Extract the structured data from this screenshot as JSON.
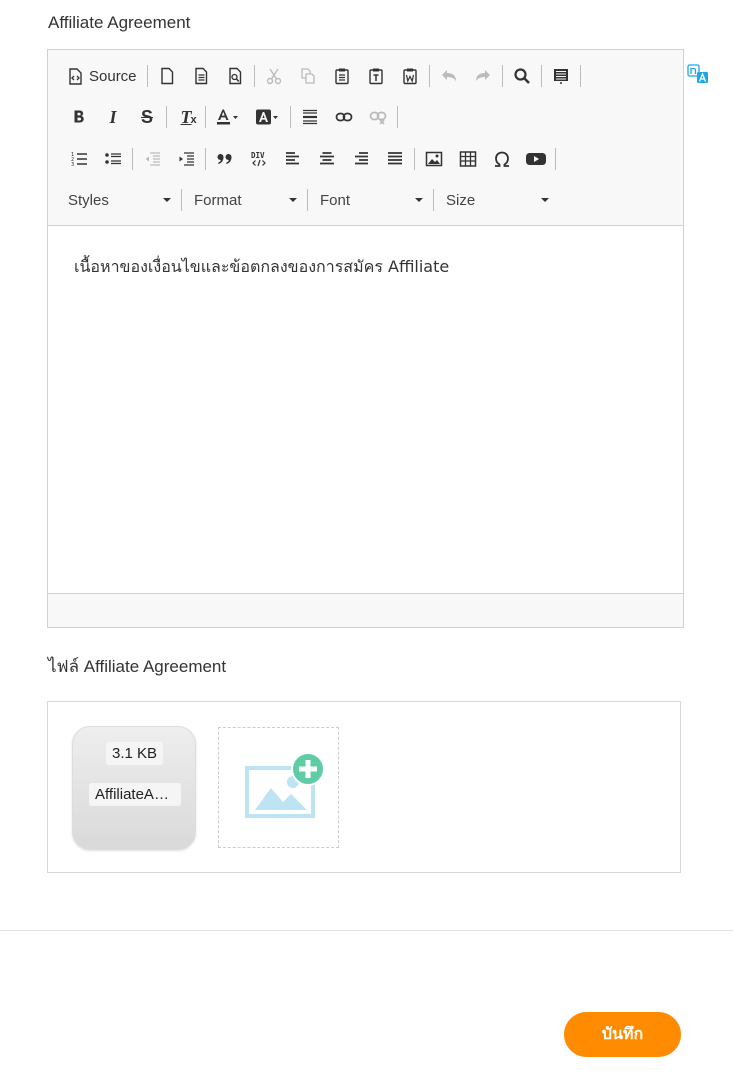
{
  "page": {
    "agreement_title": "Affiliate Agreement",
    "file_section_title": "ไฟล์ Affiliate Agreement",
    "save_label": "บันทึก"
  },
  "editor": {
    "source_label": "Source",
    "styles_label": "Styles",
    "format_label": "Format",
    "font_label": "Font",
    "size_label": "Size",
    "italic_text": "I",
    "strike_text": "S",
    "clear_text": "T",
    "content": "เนื้อหาของเงื่อนไขและข้อตกลงของการสมัคร Affiliate"
  },
  "file": {
    "size": "3.1 KB",
    "name": "AffiliateAgreement"
  },
  "colors": {
    "accent": "#ff8c00",
    "toolbar_bg": "#f8f8f8",
    "border": "#d1d1d1",
    "add_icon_green": "#5fcca5",
    "image_icon_blue": "#bde4f3"
  },
  "icons": [
    "source-icon",
    "new-page-icon",
    "templates-icon",
    "preview-icon",
    "cut-icon",
    "copy-icon",
    "paste-icon",
    "paste-text-icon",
    "paste-word-icon",
    "undo-icon",
    "redo-icon",
    "find-icon",
    "select-all-icon",
    "bold-icon",
    "italic-icon",
    "strikethrough-icon",
    "remove-format-icon",
    "text-color-icon",
    "bg-color-icon",
    "horizontal-line-icon",
    "link-icon",
    "unlink-icon",
    "numbered-list-icon",
    "bulleted-list-icon",
    "outdent-icon",
    "indent-icon",
    "blockquote-icon",
    "div-icon",
    "align-left-icon",
    "align-center-icon",
    "align-right-icon",
    "justify-icon",
    "image-icon",
    "table-icon",
    "special-char-icon",
    "youtube-icon",
    "translate-icon",
    "add-file-icon"
  ]
}
